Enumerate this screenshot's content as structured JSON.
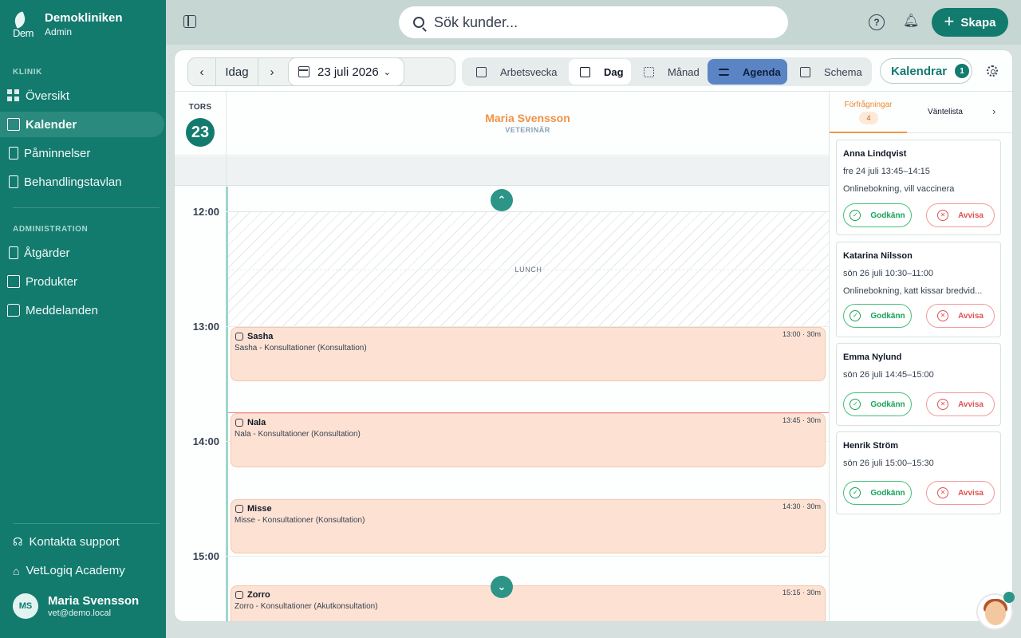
{
  "sidebar": {
    "brand_name": "Demokliniken",
    "brand_role": "Admin",
    "logo_text": "Dem",
    "section_clinic": "KLINIK",
    "section_admin": "ADMINISTRATION",
    "clinic_items": [
      {
        "label": "Översikt",
        "icon": "grid-icon"
      },
      {
        "label": "Kalender",
        "icon": "calendar-icon",
        "active": true
      },
      {
        "label": "Påminnelser",
        "icon": "document-icon"
      },
      {
        "label": "Behandlingstavlan",
        "icon": "document-icon"
      }
    ],
    "admin_items": [
      {
        "label": "Åtgärder",
        "icon": "document-icon"
      },
      {
        "label": "Produkter",
        "icon": "box-icon"
      },
      {
        "label": "Meddelanden",
        "icon": "message-icon"
      }
    ],
    "support_label": "Kontakta support",
    "academy_label": "VetLogiq Academy",
    "user": {
      "initials": "MS",
      "name": "Maria Svensson",
      "email": "vet@demo.local"
    }
  },
  "topbar": {
    "search_placeholder": "Sök kunder...",
    "create_label": "Skapa"
  },
  "toolbar": {
    "today_label": "Idag",
    "date_label": "23 juli 2026",
    "views": [
      {
        "label": "Arbetsvecka",
        "icon": "calendar-icon"
      },
      {
        "label": "Dag",
        "icon": "calendar-icon",
        "state": "selected"
      },
      {
        "label": "Månad",
        "icon": "grid-icon"
      },
      {
        "label": "Agenda",
        "icon": "list-icon",
        "state": "highlighted"
      },
      {
        "label": "Schema",
        "icon": "table-icon"
      }
    ],
    "calendars_label": "Kalendrar",
    "calendars_count": "1"
  },
  "calendar": {
    "day_name": "TORS",
    "day_number": "23",
    "resource_name": "Maria Svensson",
    "resource_role": "VETERINÄR",
    "hours": [
      "12:00",
      "13:00",
      "14:00",
      "15:00"
    ],
    "lunch_label": "LUNCH",
    "appointments": [
      {
        "name": "Sasha",
        "description": "Sasha - Konsultationer (Konsultation)",
        "time": "13:00 · 30m"
      },
      {
        "name": "Nala",
        "description": "Nala - Konsultationer (Konsultation)",
        "time": "13:45 · 30m"
      },
      {
        "name": "Misse",
        "description": "Misse - Konsultationer (Konsultation)",
        "time": "14:30 · 30m"
      },
      {
        "name": "Zorro",
        "description": "Zorro - Konsultationer (Akutkonsultation)",
        "time": "15:15 · 30m"
      }
    ]
  },
  "requests_panel": {
    "tab_requests": "Förfrågningar",
    "tab_requests_count": "4",
    "tab_waitlist": "Väntelista",
    "approve_label": "Godkänn",
    "reject_label": "Avvisa",
    "requests": [
      {
        "name": "Anna Lindqvist",
        "time": "fre 24 juli 13:45–14:15",
        "note": "Onlinebokning, vill vaccinera"
      },
      {
        "name": "Katarina Nilsson",
        "time": "sön 26 juli 10:30–11:00",
        "note": "Onlinebokning, katt kissar bredvid..."
      },
      {
        "name": "Emma Nylund",
        "time": "sön 26 juli 14:45–15:00",
        "note": ""
      },
      {
        "name": "Henrik Ström",
        "time": "sön 26 juli 15:00–15:30",
        "note": ""
      }
    ]
  },
  "colors": {
    "brand": "#137a6e",
    "appointment": "#fde2d3",
    "accent_orange": "#f09245",
    "agenda_highlight": "#5b84c4"
  }
}
